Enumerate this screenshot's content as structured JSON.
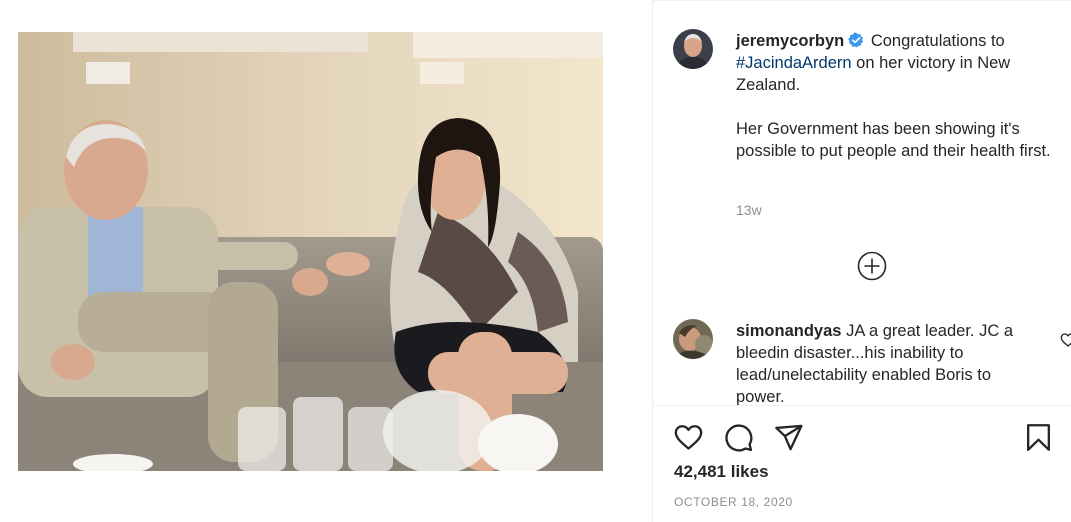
{
  "post": {
    "photo_alt": "",
    "author": {
      "username": "jeremycorbyn",
      "verified": true
    },
    "caption": {
      "lead": "Congratulations to ",
      "hashtag": "#JacindaArdern",
      "rest": " on her victory in New Zealand.",
      "paragraph2": "Her Government has been showing it's possible to put people and their health first."
    },
    "time_ago": "13w",
    "load_more_icon": "plus-circle-icon",
    "comments": [
      {
        "username": "simonandyas",
        "text": "JA a great leader. JC a bleedin disaster...his inability to lead/unelectability enabled Boris to power."
      }
    ],
    "actions": {
      "like_icon": "heart-icon",
      "comment_icon": "comment-icon",
      "share_icon": "share-icon",
      "save_icon": "bookmark-icon"
    },
    "likes_count": "42,481 likes",
    "date": "OCTOBER 18, 2020"
  },
  "colors": {
    "text": "#262626",
    "muted": "#8e8e8e",
    "hashtag": "#00376b",
    "verified": "#3897f0",
    "border": "#efefef"
  }
}
